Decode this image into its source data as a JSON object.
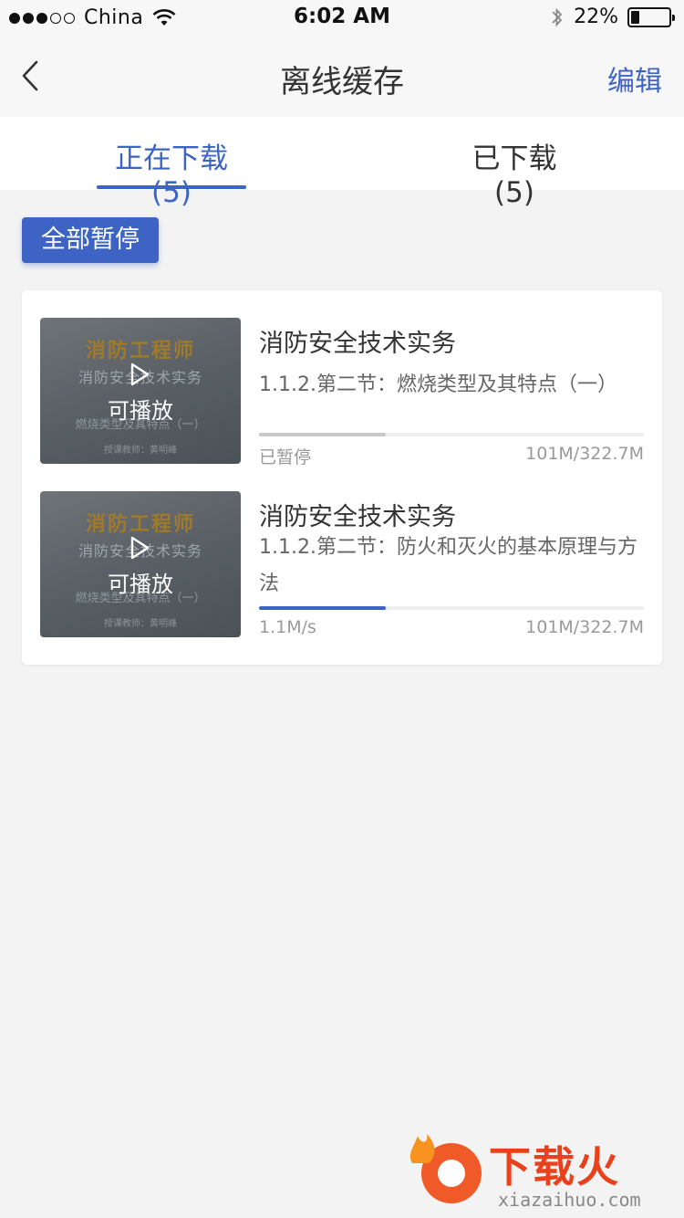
{
  "status_bar": {
    "carrier": "China",
    "time": "6:02 AM",
    "battery": "22%",
    "battery_level": 0.22
  },
  "nav": {
    "title": "离线缓存",
    "edit_label": "编辑"
  },
  "tabs": [
    {
      "label": "正在下载(5)",
      "active": true
    },
    {
      "label": "已下载(5)",
      "active": false
    }
  ],
  "pause_all_label": "全部暂停",
  "downloads": [
    {
      "title": "消防安全技术实务",
      "subtitle": "1.1.2.第二节：燃烧类型及其特点（一）",
      "thumb_title": "消防工程师",
      "thumb_sub": "消防安全技术实务",
      "thumb_sub2": "燃烧类型及其特点（一）",
      "thumb_teacher": "授课教师：黄明峰",
      "playable": "可播放",
      "progress": 0.33,
      "status": "已暂停",
      "size": "101M/322.7M"
    },
    {
      "title": "消防安全技术实务",
      "subtitle": "1.1.2.第二节：防火和灭火的基本原理与方法",
      "thumb_title": "消防工程师",
      "thumb_sub": "消防安全技术实务",
      "thumb_sub2": "燃烧类型及其特点（一）",
      "thumb_teacher": "授课教师：黄明峰",
      "playable": "可播放",
      "progress": 0.33,
      "status": "1.1M/s",
      "size": "101M/322.7M"
    }
  ],
  "watermark": {
    "text": "下载火",
    "url": "xiazaihuo.com"
  },
  "colors": {
    "accent": "#3d63c4",
    "watermark": "#e8411c"
  }
}
